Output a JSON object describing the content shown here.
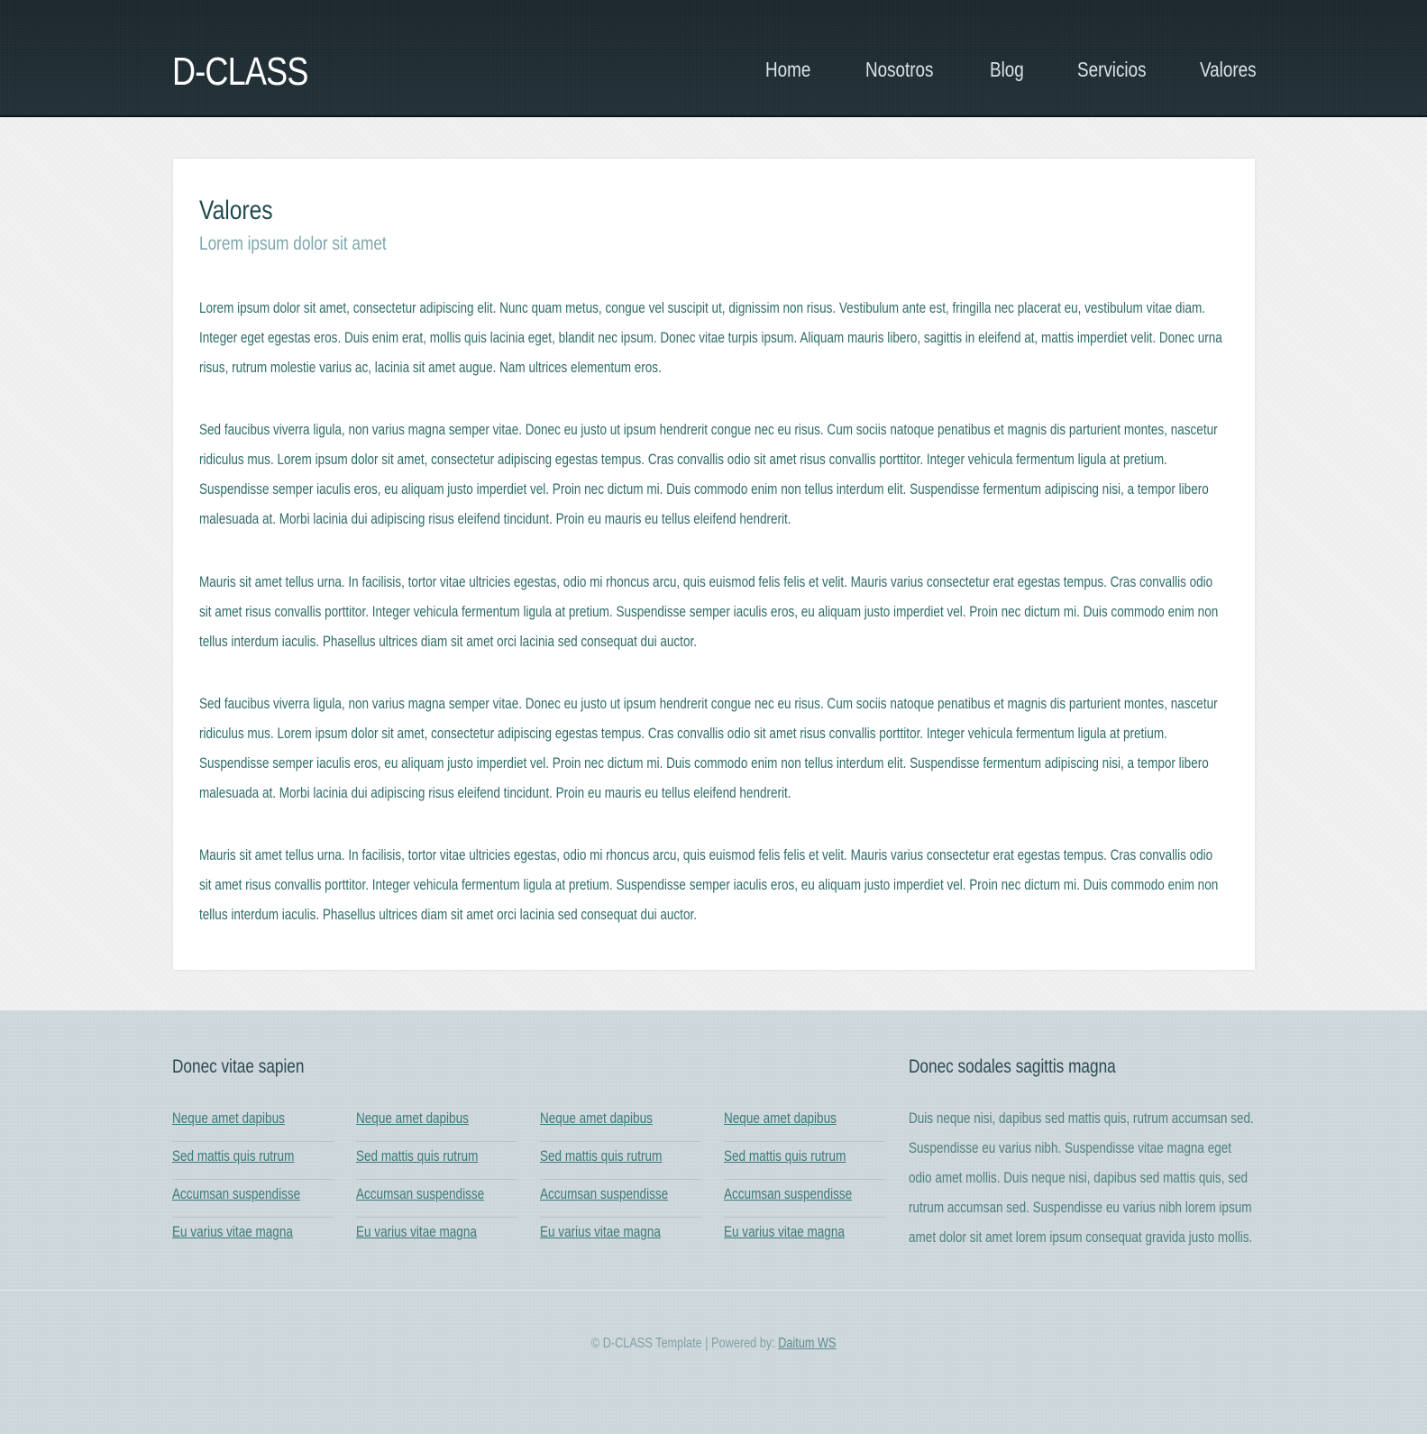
{
  "header": {
    "logo": "D-CLASS",
    "nav": [
      "Home",
      "Nosotros",
      "Blog",
      "Servicios",
      "Valores"
    ]
  },
  "main": {
    "title": "Valores",
    "subtitle": "Lorem ipsum dolor sit amet",
    "paragraphs": [
      "Lorem ipsum dolor sit amet, consectetur adipiscing elit. Nunc quam metus, congue vel suscipit ut, dignissim non risus. Vestibulum ante est, fringilla nec placerat eu, vestibulum vitae diam. Integer eget egestas eros. Duis enim erat, mollis quis lacinia eget, blandit nec ipsum. Donec vitae turpis ipsum. Aliquam mauris libero, sagittis in eleifend at, mattis imperdiet velit. Donec urna risus, rutrum molestie varius ac, lacinia sit amet augue. Nam ultrices elementum eros.",
      "Sed faucibus viverra ligula, non varius magna semper vitae. Donec eu justo ut ipsum hendrerit congue nec eu risus. Cum sociis natoque penatibus et magnis dis parturient montes, nascetur ridiculus mus. Lorem ipsum dolor sit amet, consectetur adipiscing egestas tempus. Cras convallis odio sit amet risus convallis porttitor. Integer vehicula fermentum ligula at pretium. Suspendisse semper iaculis eros, eu aliquam justo imperdiet vel. Proin nec dictum mi. Duis commodo enim non tellus interdum elit. Suspendisse fermentum adipiscing nisi, a tempor libero malesuada at. Morbi lacinia dui adipiscing risus eleifend tincidunt. Proin eu mauris eu tellus eleifend hendrerit.",
      "Mauris sit amet tellus urna. In facilisis, tortor vitae ultricies egestas, odio mi rhoncus arcu, quis euismod felis felis et velit. Mauris varius consectetur erat egestas tempus. Cras convallis odio sit amet risus convallis porttitor. Integer vehicula fermentum ligula at pretium. Suspendisse semper iaculis eros, eu aliquam justo imperdiet vel. Proin nec dictum mi. Duis commodo enim non tellus interdum iaculis. Phasellus ultrices diam sit amet orci lacinia sed consequat dui auctor.",
      "Sed faucibus viverra ligula, non varius magna semper vitae. Donec eu justo ut ipsum hendrerit congue nec eu risus. Cum sociis natoque penatibus et magnis dis parturient montes, nascetur ridiculus mus. Lorem ipsum dolor sit amet, consectetur adipiscing egestas tempus. Cras convallis odio sit amet risus convallis porttitor. Integer vehicula fermentum ligula at pretium. Suspendisse semper iaculis eros, eu aliquam justo imperdiet vel. Proin nec dictum mi. Duis commodo enim non tellus interdum elit. Suspendisse fermentum adipiscing nisi, a tempor libero malesuada at. Morbi lacinia dui adipiscing risus eleifend tincidunt. Proin eu mauris eu tellus eleifend hendrerit.",
      "Mauris sit amet tellus urna. In facilisis, tortor vitae ultricies egestas, odio mi rhoncus arcu, quis euismod felis felis et velit. Mauris varius consectetur erat egestas tempus. Cras convallis odio sit amet risus convallis porttitor. Integer vehicula fermentum ligula at pretium. Suspendisse semper iaculis eros, eu aliquam justo imperdiet vel. Proin nec dictum mi. Duis commodo enim non tellus interdum iaculis. Phasellus ultrices diam sit amet orci lacinia sed consequat dui auctor."
    ]
  },
  "footer": {
    "links_heading": "Donec vitae sapien",
    "link_columns": [
      [
        "Neque amet dapibus",
        "Sed mattis quis rutrum",
        "Accumsan suspendisse",
        "Eu varius vitae magna"
      ],
      [
        "Neque amet dapibus",
        "Sed mattis quis rutrum",
        "Accumsan suspendisse",
        "Eu varius vitae magna"
      ],
      [
        "Neque amet dapibus",
        "Sed mattis quis rutrum",
        "Accumsan suspendisse",
        "Eu varius vitae magna"
      ],
      [
        "Neque amet dapibus",
        "Sed mattis quis rutrum",
        "Accumsan suspendisse",
        "Eu varius vitae magna"
      ]
    ],
    "text_heading": "Donec sodales sagittis magna",
    "text": "Duis neque nisi, dapibus sed mattis quis, rutrum accumsan sed. Suspendisse eu varius nibh. Suspendisse vitae magna eget odio amet mollis. Duis neque nisi, dapibus sed mattis quis, sed rutrum accumsan sed. Suspendisse eu varius nibh lorem ipsum amet dolor sit amet lorem ipsum consequat gravida justo mollis.",
    "copyright": "© D-CLASS Template | Powered by:",
    "powered_link": "Daitum WS"
  },
  "colors": {
    "header_bg": "#1f2c33",
    "text": "#2f6b68",
    "subtitle": "#7fa7ad",
    "footer_bg": "#ccd6db"
  }
}
